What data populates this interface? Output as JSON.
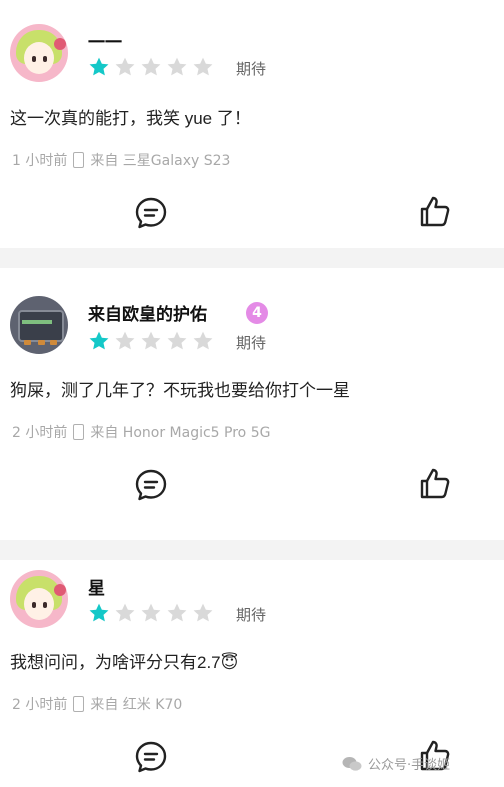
{
  "reviews": [
    {
      "username": "一一",
      "rating": 1,
      "rating_max": 5,
      "rating_label": "期待",
      "comment": "这一次真的能打，我笑 yue 了！",
      "time": "1 小时前",
      "device": "来自 三星Galaxy S23",
      "avatar": "anime-girl-avatar",
      "badge": ""
    },
    {
      "username": "来自欧皇的护佑",
      "rating": 1,
      "rating_max": 5,
      "rating_label": "期待",
      "comment": "狗屎，测了几年了？不玩我也要给你打个一星",
      "time": "2 小时前",
      "device": "来自 Honor Magic5 Pro 5G",
      "avatar": "device-avatar",
      "badge": "4"
    },
    {
      "username": "星",
      "rating": 1,
      "rating_max": 5,
      "rating_label": "期待",
      "comment": "我想问问，为啥评分只有2.7😇",
      "time": "2 小时前",
      "device": "来自 红米 K70",
      "avatar": "anime-girl-avatar",
      "badge": ""
    }
  ],
  "icons": {
    "comment": "comment-bubble-icon",
    "like": "thumbs-up-icon",
    "device": "phone-icon"
  },
  "colors": {
    "star_active": "#14c8c8",
    "star_inactive": "#d9d9d9",
    "badge": "#e48be6"
  },
  "watermark": {
    "text": "公众号·手谈姬"
  }
}
